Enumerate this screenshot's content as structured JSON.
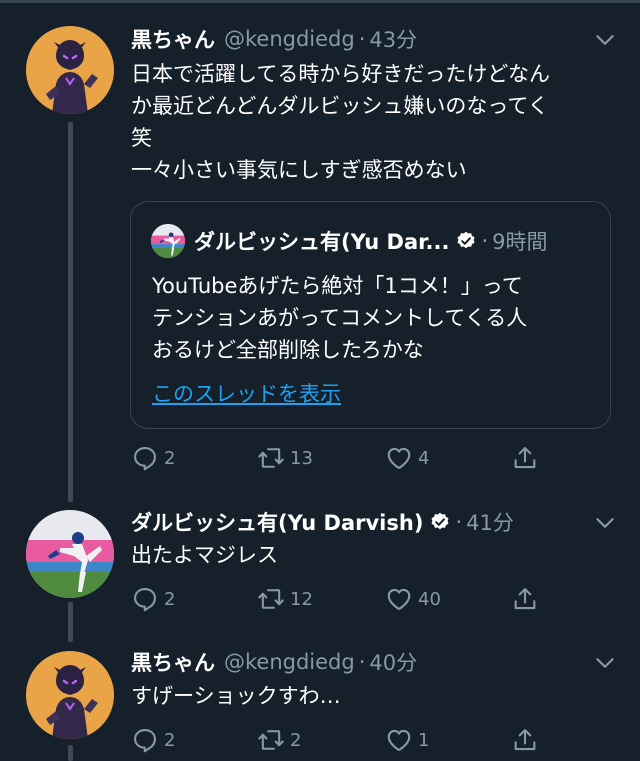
{
  "colors": {
    "background": "#15202b",
    "text": "#ffffff",
    "muted": "#8899a6",
    "link": "#1da1f2",
    "border": "#38444d",
    "verified": "#ffffff"
  },
  "tweets": [
    {
      "display_name": "黒ちゃん",
      "handle": "@kengdiedg",
      "time": "43分",
      "text_lines": [
        "日本で活躍してる時から好きだったけどなん",
        "か最近どんどんダルビッシュ嫌いのなってく",
        "笑",
        "一々小さい事気にしすぎ感否めない"
      ],
      "quote": {
        "display_name": "ダルビッシュ有(Yu Dar...",
        "time": "9時間",
        "text_lines": [
          "YouTubeあげたら絶対「1コメ！」って",
          "テンションあがってコメントしてくる人",
          "おるけど全部削除したろかな"
        ],
        "link": "このスレッドを表示"
      },
      "counts": {
        "reply": "2",
        "retweet": "13",
        "like": "4"
      }
    },
    {
      "display_name": "ダルビッシュ有(Yu Darvish)",
      "time": "41分",
      "text_lines": [
        "出たよマジレス"
      ],
      "counts": {
        "reply": "2",
        "retweet": "12",
        "like": "40"
      }
    },
    {
      "display_name": "黒ちゃん",
      "handle": "@kengdiedg",
      "time": "40分",
      "text_lines": [
        "すげーショックすわ…"
      ],
      "counts": {
        "reply": "2",
        "retweet": "2",
        "like": "1"
      }
    }
  ],
  "dot": "·"
}
